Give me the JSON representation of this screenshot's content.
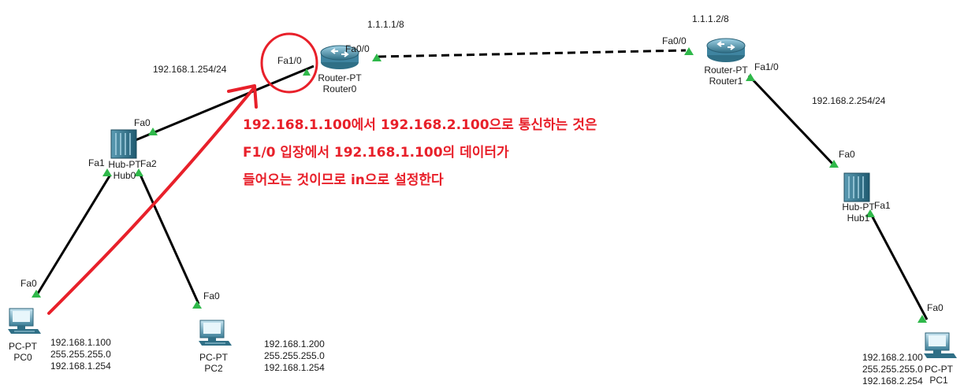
{
  "networks": {
    "link_r0_r1": "1.1.1.1/8",
    "link_r1_ip": "1.1.1.2/8",
    "lan0_gateway": "192.168.1.254/24",
    "lan1_gateway": "192.168.2.254/24"
  },
  "ports": {
    "r0_fa10": "Fa1/0",
    "r0_fa00": "Fa0/0",
    "r1_fa00": "Fa0/0",
    "r1_fa10": "Fa1/0",
    "hub0_fa0": "Fa0",
    "hub0_fa1": "Fa1",
    "hub0_fa2": "Fa2",
    "pc0_fa0": "Fa0",
    "pc2_fa0": "Fa0",
    "hub1_fa0": "Fa0",
    "hub1_fa1": "Fa1",
    "pc1_fa0": "Fa0"
  },
  "devices": {
    "router0": {
      "type": "Router-PT",
      "name": "Router0"
    },
    "router1": {
      "type": "Router-PT",
      "name": "Router1"
    },
    "hub0": {
      "type": "Hub-PT",
      "name": "Hub0"
    },
    "hub1": {
      "type": "Hub-PT",
      "name": "Hub1"
    },
    "pc0": {
      "type": "PC-PT",
      "name": "PC0"
    },
    "pc1": {
      "type": "PC-PT",
      "name": "PC1"
    },
    "pc2": {
      "type": "PC-PT",
      "name": "PC2"
    }
  },
  "hosts": {
    "pc0": {
      "ip": "192.168.1.100",
      "mask": "255.255.255.0",
      "gateway": "192.168.1.254"
    },
    "pc2": {
      "ip": "192.168.1.200",
      "mask": "255.255.255.0",
      "gateway": "192.168.1.254"
    },
    "pc1": {
      "ip": "192.168.2.100",
      "mask": "255.255.255.0",
      "gateway": "192.168.2.254"
    }
  },
  "annotation": {
    "line1": "192.168.1.100에서 192.168.2.100으로 통신하는 것은",
    "line2": "F1/0 입장에서 192.168.1.100의 데이터가",
    "line3": "들어오는 것이므로 in으로 설정한다",
    "color": "#e8202a"
  },
  "colors": {
    "cable": "#000000",
    "link_up": "#2fb84a",
    "device_body": "#2f6f86"
  }
}
